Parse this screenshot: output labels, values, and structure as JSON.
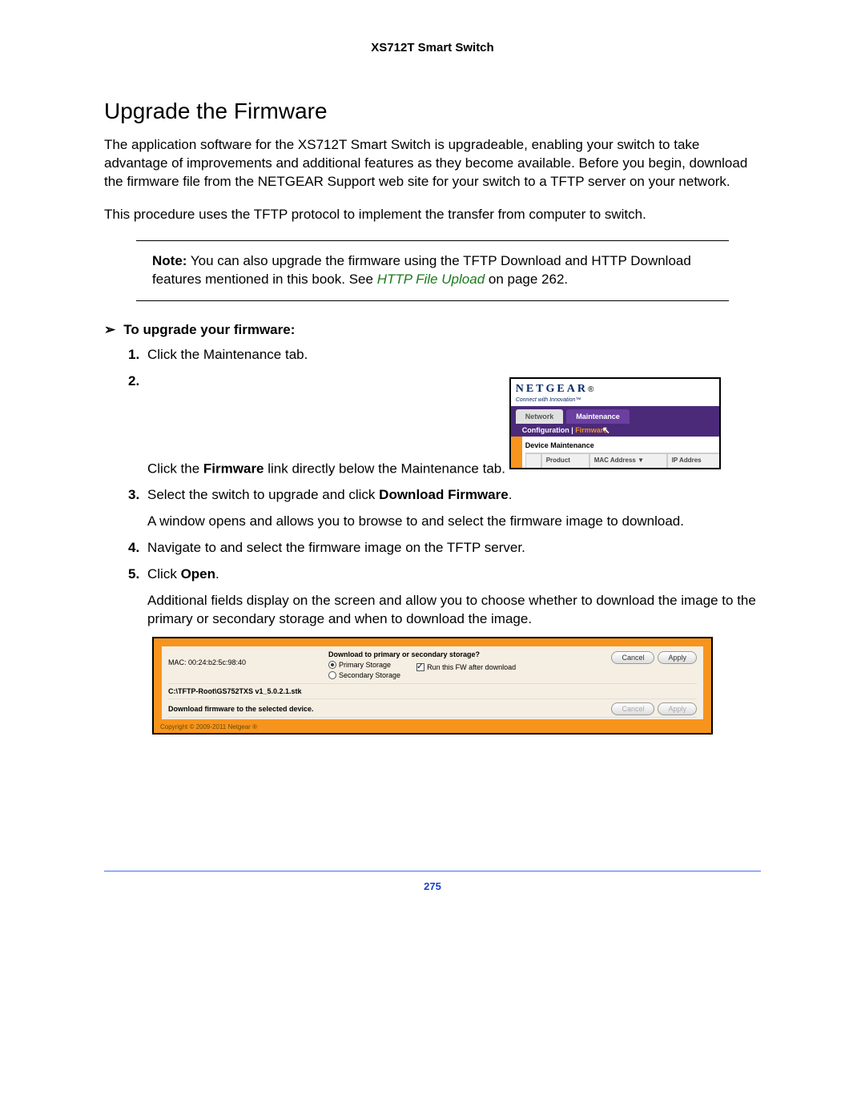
{
  "header": {
    "product": "XS712T Smart Switch"
  },
  "section": {
    "title": "Upgrade the Firmware",
    "para1": "The application software for the XS712T Smart Switch is upgradeable, enabling your switch to take advantage of improvements and additional features as they become available. Before you begin, download the firmware file from the NETGEAR Support web site for your switch to a TFTP server on your network.",
    "para2": "This procedure uses the TFTP protocol to implement the transfer from computer to switch."
  },
  "note": {
    "label": "Note:",
    "text_before_link": " You can also upgrade the firmware using the TFTP Download and HTTP Download features mentioned in this book. See ",
    "link_text": "HTTP File Upload",
    "text_after_link": " on page 262."
  },
  "procedure": {
    "chevron": "➢",
    "title": "To upgrade your firmware:",
    "steps": {
      "s1": "Click the Maintenance tab.",
      "s2_a": "Click the ",
      "s2_b": "Firmware",
      "s2_c": " link directly below the Maintenance tab.",
      "s3_a": "Select the switch to upgrade and click ",
      "s3_b": "Download Firmware",
      "s3_c": ".",
      "s3_extra": "A window opens and allows you to browse to and select the firmware image to download.",
      "s4": "Navigate to and select the firmware image on the TFTP server.",
      "s5_a": "Click ",
      "s5_b": "Open",
      "s5_c": ".",
      "s5_extra": "Additional fields display on the screen and allow you to choose whether to download the image to the primary or secondary storage and when to download the image."
    }
  },
  "shot1": {
    "logo_main": "NETGEAR",
    "logo_reg": "®",
    "logo_tag": "Connect with Innovation™",
    "tab_network": "Network",
    "tab_maintenance": "Maintenance",
    "subbar_config": "Configuration",
    "subbar_sep": " | ",
    "subbar_firmware": "Firmware",
    "dm_title": "Device Maintenance",
    "col_product": "Product",
    "col_mac": "MAC Address  ▼",
    "col_ip": "IP Addres"
  },
  "shot2": {
    "mac_label": "MAC: 00:24:b2:5c:98:40",
    "question": "Download to primary or secondary storage?",
    "opt_primary": "Primary Storage",
    "opt_secondary": "Secondary Storage",
    "cb_label": "Run this FW after download",
    "btn_cancel": "Cancel",
    "btn_apply": "Apply",
    "path": "C:\\TFTP-Root\\GS752TXS v1_5.0.2.1.stk",
    "dl_msg": "Download firmware to the selected device.",
    "copyright": "Copyright © 2009-2011 Netgear ®"
  },
  "footer": {
    "page_number": "275"
  }
}
